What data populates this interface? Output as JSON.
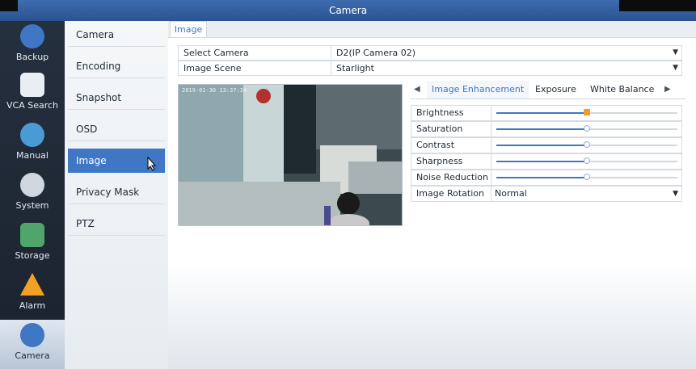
{
  "window": {
    "title": "Camera"
  },
  "sidebar": {
    "items": [
      {
        "label": "Backup",
        "icon": "backup-icon"
      },
      {
        "label": "VCA Search",
        "icon": "vca-search-icon"
      },
      {
        "label": "Manual",
        "icon": "manual-icon"
      },
      {
        "label": "System",
        "icon": "gear-icon"
      },
      {
        "label": "Storage",
        "icon": "storage-icon"
      },
      {
        "label": "Alarm",
        "icon": "alarm-icon"
      },
      {
        "label": "Camera",
        "icon": "camera-icon",
        "active": true
      }
    ]
  },
  "submenu": {
    "items": [
      "Camera",
      "Encoding",
      "Snapshot",
      "OSD",
      "Image",
      "Privacy Mask",
      "PTZ"
    ],
    "active": "Image"
  },
  "page": {
    "tab": "Image"
  },
  "form": {
    "select_camera": {
      "label": "Select Camera",
      "value": "D2(IP Camera 02)"
    },
    "image_scene": {
      "label": "Image Scene",
      "value": "Starlight"
    }
  },
  "preview": {
    "timestamp": "2019-01-30 13:37:34"
  },
  "adjust": {
    "tabs": [
      "Image Enhancement",
      "Exposure",
      "White Balance"
    ],
    "active_tab": "Image Enhancement",
    "rows": [
      {
        "label": "Brightness",
        "level": 0.5
      },
      {
        "label": "Saturation",
        "level": 0.5
      },
      {
        "label": "Contrast",
        "level": 0.5
      },
      {
        "label": "Sharpness",
        "level": 0.5
      },
      {
        "label": "Noise Reduction",
        "level": 0.5
      }
    ],
    "rotation": {
      "label": "Image Rotation",
      "value": "Normal"
    }
  },
  "colors": {
    "accent": "#3f77c4",
    "slider_active": "#f59a22"
  }
}
